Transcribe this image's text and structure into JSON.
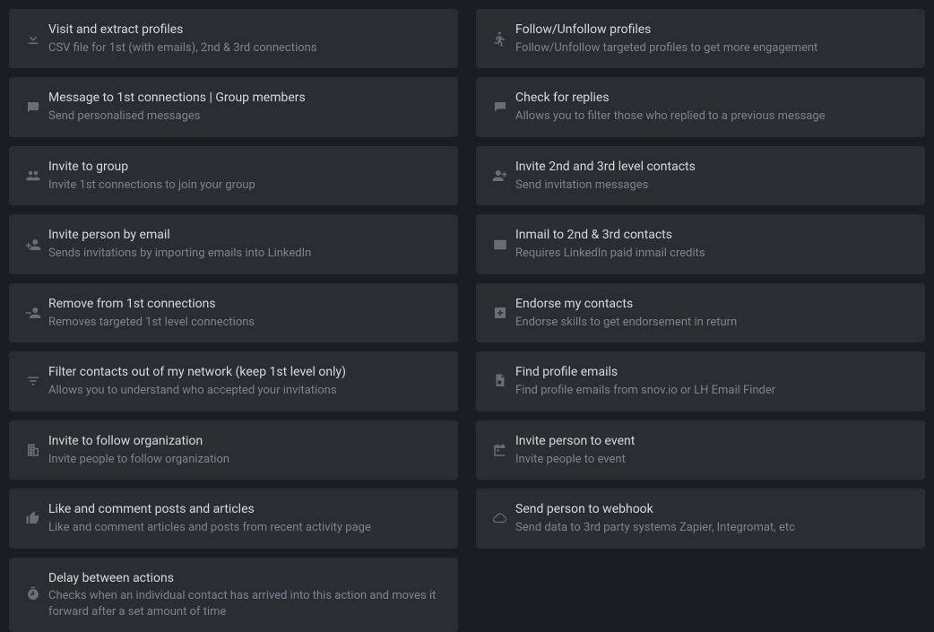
{
  "left": [
    {
      "icon": "download",
      "title": "Visit and extract profiles",
      "desc": "CSV file for 1st (with emails), 2nd & 3rd connections"
    },
    {
      "icon": "message",
      "title": "Message to 1st connections | Group members",
      "desc": "Send personalised messages"
    },
    {
      "icon": "group",
      "title": "Invite to group",
      "desc": "Invite 1st connections to join your group"
    },
    {
      "icon": "person-add",
      "title": "Invite person by email",
      "desc": "Sends invitations by importing emails into LinkedIn"
    },
    {
      "icon": "person-remove",
      "title": "Remove from 1st connections",
      "desc": "Removes targeted 1st level connections"
    },
    {
      "icon": "filter",
      "title": "Filter contacts out of my network (keep 1st level only)",
      "desc": "Allows you to understand who accepted your invitations"
    },
    {
      "icon": "building",
      "title": "Invite to follow organization",
      "desc": "Invite people to follow organization"
    },
    {
      "icon": "thumb-up",
      "title": "Like and comment posts and articles",
      "desc": "Like and comment articles and posts from recent activity page"
    },
    {
      "icon": "timer",
      "title": "Delay between actions",
      "desc": "Checks when an individual contact has arrived into this action and moves it forward after a set amount of time"
    }
  ],
  "right": [
    {
      "icon": "run",
      "title": "Follow/Unfollow profiles",
      "desc": "Follow/Unfollow targeted profiles to get more engagement"
    },
    {
      "icon": "chat",
      "title": "Check for replies",
      "desc": "Allows you to filter those who replied to a previous message"
    },
    {
      "icon": "person-plus",
      "title": "Invite 2nd and 3rd level contacts",
      "desc": "Send invitation messages"
    },
    {
      "icon": "mail",
      "title": "Inmail to 2nd & 3rd contacts",
      "desc": "Requires LinkedIn paid inmail credits"
    },
    {
      "icon": "plus-box",
      "title": "Endorse my contacts",
      "desc": "Endorse skills to get endorsement in return"
    },
    {
      "icon": "file-search",
      "title": "Find profile emails",
      "desc": "Find profile emails from snov.io or LH Email Finder"
    },
    {
      "icon": "calendar",
      "title": "Invite person to event",
      "desc": "Invite people to event"
    },
    {
      "icon": "cloud",
      "title": "Send person to webhook",
      "desc": "Send data to 3rd party systems Zapier, Integromat, etc"
    }
  ]
}
